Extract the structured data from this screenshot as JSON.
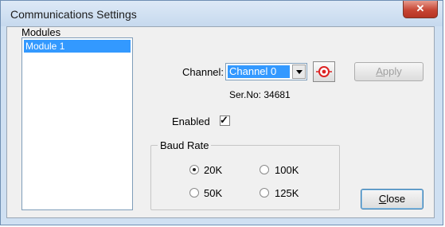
{
  "window": {
    "title": "Communications Settings"
  },
  "modules": {
    "label": "Modules",
    "items": [
      "Module 1"
    ]
  },
  "channel": {
    "label": "Channel:",
    "value": "Channel 0"
  },
  "serial": "Ser.No: 34681",
  "apply_label": "Apply",
  "enabled": {
    "label": "Enabled",
    "checked": true
  },
  "baud": {
    "label": "Baud Rate",
    "options": [
      "20K",
      "100K",
      "50K",
      "125K"
    ],
    "selected": "20K"
  },
  "close_label": "Close",
  "colors": {
    "selection": "#3399ff",
    "title_close": "#c74634"
  }
}
